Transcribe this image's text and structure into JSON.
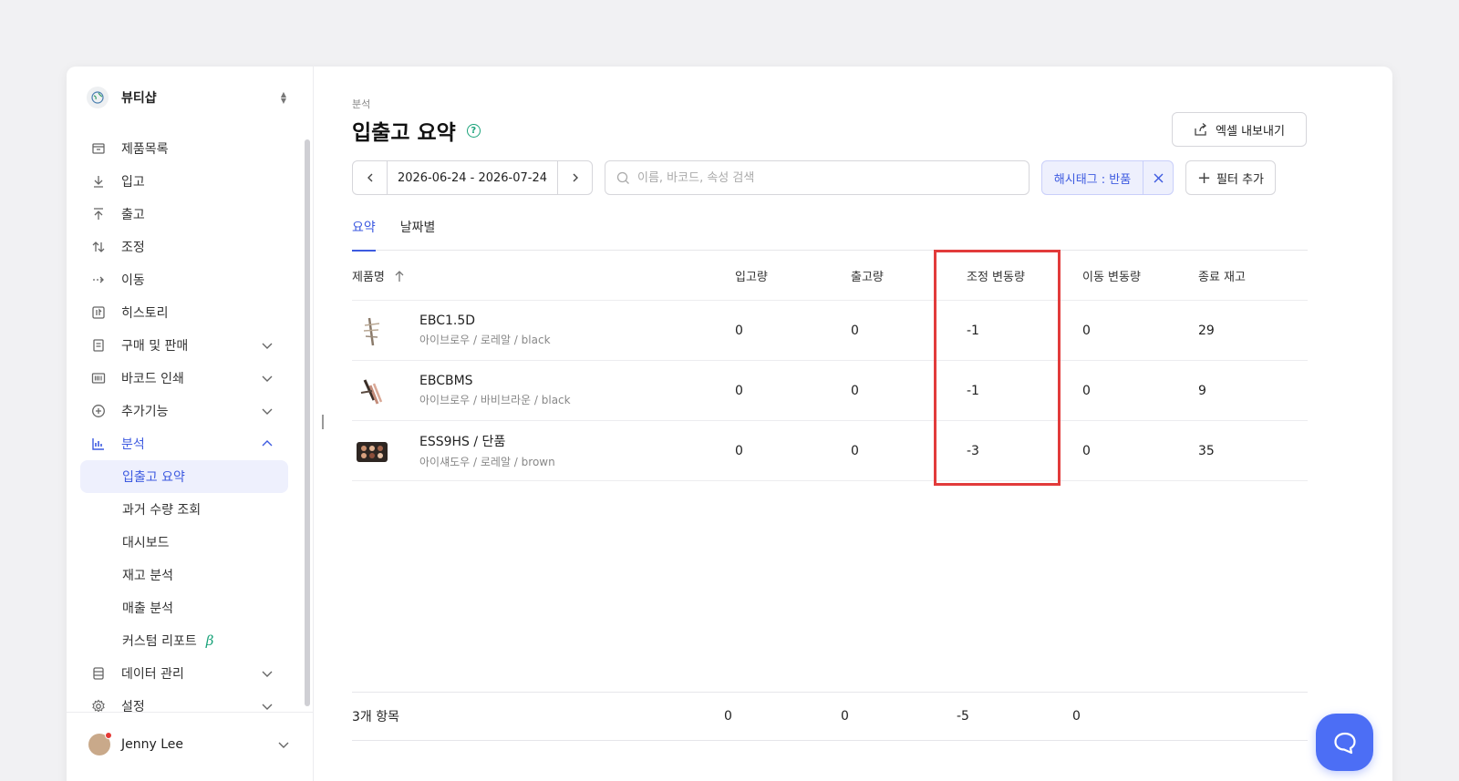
{
  "store": {
    "name": "뷰티샵"
  },
  "nav": {
    "items": [
      {
        "label": "제품목록",
        "icon": "box-icon"
      },
      {
        "label": "입고",
        "icon": "arrow-down-icon"
      },
      {
        "label": "출고",
        "icon": "arrow-up-icon"
      },
      {
        "label": "조정",
        "icon": "swap-vertical-icon"
      },
      {
        "label": "이동",
        "icon": "arrow-right-icon"
      },
      {
        "label": "히스토리",
        "icon": "history-icon"
      },
      {
        "label": "구매 및 판매",
        "icon": "document-icon"
      },
      {
        "label": "바코드 인쇄",
        "icon": "barcode-icon"
      },
      {
        "label": "추가기능",
        "icon": "plus-circle-icon"
      },
      {
        "label": "분석",
        "icon": "chart-icon"
      }
    ],
    "analysis_sub": [
      {
        "label": "입출고 요약"
      },
      {
        "label": "과거 수량 조회"
      },
      {
        "label": "대시보드"
      },
      {
        "label": "재고 분석"
      },
      {
        "label": "매출 분석"
      },
      {
        "label": "커스텀 리포트",
        "badge": "β"
      }
    ],
    "bottom_items": [
      {
        "label": "데이터 관리",
        "icon": "database-icon"
      },
      {
        "label": "설정",
        "icon": "gear-icon"
      }
    ]
  },
  "user": {
    "name": "Jenny Lee"
  },
  "page": {
    "breadcrumb": "분석",
    "title": "입출고 요약",
    "help_glyph": "?",
    "export_label": "엑셀 내보내기"
  },
  "filters": {
    "date_range": "2026-06-24 - 2026-07-24",
    "search_placeholder": "이름, 바코드, 속성 검색",
    "chip_label": "해시태그 : 반품",
    "add_filter_label": "필터 추가"
  },
  "tabs": [
    "요약",
    "날짜별"
  ],
  "table": {
    "headers": [
      "제품명",
      "입고량",
      "출고량",
      "조정 변동량",
      "이동 변동량",
      "종료 재고"
    ],
    "rows": [
      {
        "name": "EBC1.5D",
        "variant": "아이브로우 / 로레알 / black",
        "in": "0",
        "out": "0",
        "adjust": "-1",
        "move": "0",
        "end": "29"
      },
      {
        "name": "EBCBMS",
        "variant": "아이브로우 / 바비브라운 / black",
        "in": "0",
        "out": "0",
        "adjust": "-1",
        "move": "0",
        "end": "9"
      },
      {
        "name": "ESS9HS / 단품",
        "variant": "아이섀도우 / 로레알 / brown",
        "in": "0",
        "out": "0",
        "adjust": "-3",
        "move": "0",
        "end": "35"
      }
    ],
    "footer": {
      "count": "3개 항목",
      "in": "0",
      "out": "0",
      "adjust": "-5",
      "move": "0"
    }
  },
  "colors": {
    "accent": "#3d5ae0",
    "highlight": "#e23b3b",
    "chat": "#4c6ef5"
  }
}
